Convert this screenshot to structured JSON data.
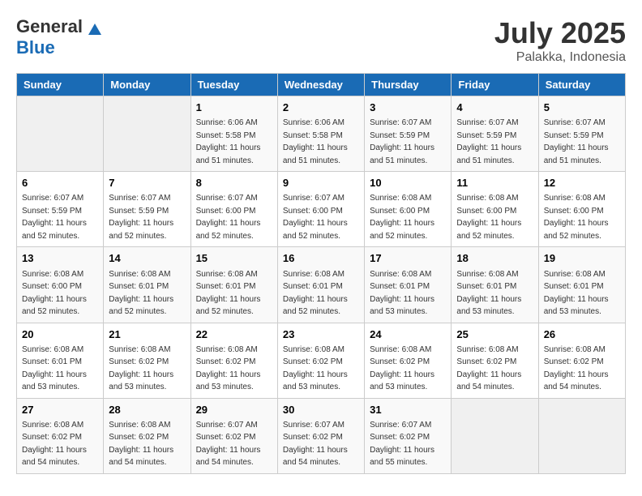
{
  "logo": {
    "general": "General",
    "blue": "Blue"
  },
  "title": "July 2025",
  "location": "Palakka, Indonesia",
  "weekdays": [
    "Sunday",
    "Monday",
    "Tuesday",
    "Wednesday",
    "Thursday",
    "Friday",
    "Saturday"
  ],
  "weeks": [
    [
      {
        "day": "",
        "empty": true
      },
      {
        "day": "",
        "empty": true
      },
      {
        "day": "1",
        "sunrise": "6:06 AM",
        "sunset": "5:58 PM",
        "daylight": "11 hours and 51 minutes."
      },
      {
        "day": "2",
        "sunrise": "6:06 AM",
        "sunset": "5:58 PM",
        "daylight": "11 hours and 51 minutes."
      },
      {
        "day": "3",
        "sunrise": "6:07 AM",
        "sunset": "5:59 PM",
        "daylight": "11 hours and 51 minutes."
      },
      {
        "day": "4",
        "sunrise": "6:07 AM",
        "sunset": "5:59 PM",
        "daylight": "11 hours and 51 minutes."
      },
      {
        "day": "5",
        "sunrise": "6:07 AM",
        "sunset": "5:59 PM",
        "daylight": "11 hours and 51 minutes."
      }
    ],
    [
      {
        "day": "6",
        "sunrise": "6:07 AM",
        "sunset": "5:59 PM",
        "daylight": "11 hours and 52 minutes."
      },
      {
        "day": "7",
        "sunrise": "6:07 AM",
        "sunset": "5:59 PM",
        "daylight": "11 hours and 52 minutes."
      },
      {
        "day": "8",
        "sunrise": "6:07 AM",
        "sunset": "6:00 PM",
        "daylight": "11 hours and 52 minutes."
      },
      {
        "day": "9",
        "sunrise": "6:07 AM",
        "sunset": "6:00 PM",
        "daylight": "11 hours and 52 minutes."
      },
      {
        "day": "10",
        "sunrise": "6:08 AM",
        "sunset": "6:00 PM",
        "daylight": "11 hours and 52 minutes."
      },
      {
        "day": "11",
        "sunrise": "6:08 AM",
        "sunset": "6:00 PM",
        "daylight": "11 hours and 52 minutes."
      },
      {
        "day": "12",
        "sunrise": "6:08 AM",
        "sunset": "6:00 PM",
        "daylight": "11 hours and 52 minutes."
      }
    ],
    [
      {
        "day": "13",
        "sunrise": "6:08 AM",
        "sunset": "6:00 PM",
        "daylight": "11 hours and 52 minutes."
      },
      {
        "day": "14",
        "sunrise": "6:08 AM",
        "sunset": "6:01 PM",
        "daylight": "11 hours and 52 minutes."
      },
      {
        "day": "15",
        "sunrise": "6:08 AM",
        "sunset": "6:01 PM",
        "daylight": "11 hours and 52 minutes."
      },
      {
        "day": "16",
        "sunrise": "6:08 AM",
        "sunset": "6:01 PM",
        "daylight": "11 hours and 52 minutes."
      },
      {
        "day": "17",
        "sunrise": "6:08 AM",
        "sunset": "6:01 PM",
        "daylight": "11 hours and 53 minutes."
      },
      {
        "day": "18",
        "sunrise": "6:08 AM",
        "sunset": "6:01 PM",
        "daylight": "11 hours and 53 minutes."
      },
      {
        "day": "19",
        "sunrise": "6:08 AM",
        "sunset": "6:01 PM",
        "daylight": "11 hours and 53 minutes."
      }
    ],
    [
      {
        "day": "20",
        "sunrise": "6:08 AM",
        "sunset": "6:01 PM",
        "daylight": "11 hours and 53 minutes."
      },
      {
        "day": "21",
        "sunrise": "6:08 AM",
        "sunset": "6:02 PM",
        "daylight": "11 hours and 53 minutes."
      },
      {
        "day": "22",
        "sunrise": "6:08 AM",
        "sunset": "6:02 PM",
        "daylight": "11 hours and 53 minutes."
      },
      {
        "day": "23",
        "sunrise": "6:08 AM",
        "sunset": "6:02 PM",
        "daylight": "11 hours and 53 minutes."
      },
      {
        "day": "24",
        "sunrise": "6:08 AM",
        "sunset": "6:02 PM",
        "daylight": "11 hours and 53 minutes."
      },
      {
        "day": "25",
        "sunrise": "6:08 AM",
        "sunset": "6:02 PM",
        "daylight": "11 hours and 54 minutes."
      },
      {
        "day": "26",
        "sunrise": "6:08 AM",
        "sunset": "6:02 PM",
        "daylight": "11 hours and 54 minutes."
      }
    ],
    [
      {
        "day": "27",
        "sunrise": "6:08 AM",
        "sunset": "6:02 PM",
        "daylight": "11 hours and 54 minutes."
      },
      {
        "day": "28",
        "sunrise": "6:08 AM",
        "sunset": "6:02 PM",
        "daylight": "11 hours and 54 minutes."
      },
      {
        "day": "29",
        "sunrise": "6:07 AM",
        "sunset": "6:02 PM",
        "daylight": "11 hours and 54 minutes."
      },
      {
        "day": "30",
        "sunrise": "6:07 AM",
        "sunset": "6:02 PM",
        "daylight": "11 hours and 54 minutes."
      },
      {
        "day": "31",
        "sunrise": "6:07 AM",
        "sunset": "6:02 PM",
        "daylight": "11 hours and 55 minutes."
      },
      {
        "day": "",
        "empty": true
      },
      {
        "day": "",
        "empty": true
      }
    ]
  ],
  "labels": {
    "sunrise": "Sunrise:",
    "sunset": "Sunset:",
    "daylight": "Daylight:"
  }
}
